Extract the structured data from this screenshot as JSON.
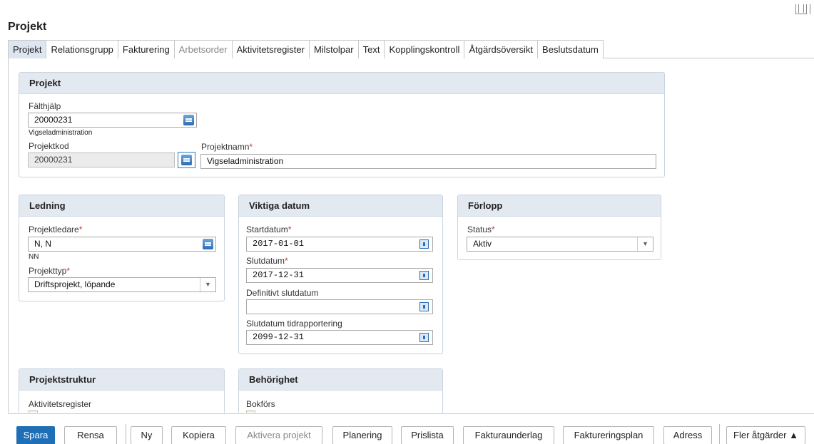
{
  "page_title": "Projekt",
  "tabs": [
    {
      "label": "Projekt",
      "active": true
    },
    {
      "label": "Relationsgrupp"
    },
    {
      "label": "Fakturering"
    },
    {
      "label": "Arbetsorder",
      "disabled": true
    },
    {
      "label": "Aktivitetsregister"
    },
    {
      "label": "Milstolpar"
    },
    {
      "label": "Text"
    },
    {
      "label": "Kopplingskontroll"
    },
    {
      "label": "Åtgärdsöversikt"
    },
    {
      "label": "Beslutsdatum"
    }
  ],
  "projekt_panel": {
    "title": "Projekt",
    "falthjalp_label": "Fälthjälp",
    "falthjalp_value": "20000231",
    "falthjalp_desc": "Vigseladministration",
    "projektkod_label": "Projektkod",
    "projektkod_value": "20000231",
    "projektnamn_label": "Projektnamn",
    "projektnamn_value": "Vigseladministration"
  },
  "ledning_panel": {
    "title": "Ledning",
    "projektledare_label": "Projektledare",
    "projektledare_value": "N, N",
    "projektledare_desc": "NN",
    "projekttyp_label": "Projekttyp",
    "projekttyp_value": "Driftsprojekt, löpande"
  },
  "datum_panel": {
    "title": "Viktiga datum",
    "startdatum_label": "Startdatum",
    "startdatum_value": "2017-01-01",
    "slutdatum_label": "Slutdatum",
    "slutdatum_value": "2017-12-31",
    "definitivt_label": "Definitivt slutdatum",
    "definitivt_value": "",
    "tidrapp_label": "Slutdatum tidrapportering",
    "tidrapp_value": "2099-12-31"
  },
  "forlopp_panel": {
    "title": "Förlopp",
    "status_label": "Status",
    "status_value": "Aktiv"
  },
  "struktur_panel": {
    "title": "Projektstruktur",
    "aktivitetsregister_label": "Aktivitetsregister"
  },
  "behorighet_panel": {
    "title": "Behörighet",
    "bokfors_label": "Bokförs"
  },
  "required_mark": "*",
  "buttons": {
    "spara": "Spara",
    "rensa": "Rensa",
    "ny": "Ny",
    "kopiera": "Kopiera",
    "aktivera": "Aktivera projekt",
    "planering": "Planering",
    "prislista": "Prislista",
    "fakturaunderlag": "Fakturaunderlag",
    "faktureringsplan": "Faktureringsplan",
    "adress": "Adress",
    "fler": "Fler åtgärder ▲"
  },
  "colors": {
    "primary_button": "#1f6fb7",
    "panel_header": "#e3e9f1",
    "active_tab": "#dde5f0",
    "required": "#d0352b"
  },
  "icons": [
    "layout-icon",
    "lookup-icon",
    "calendar-icon",
    "dropdown-icon",
    "edit-icon"
  ]
}
